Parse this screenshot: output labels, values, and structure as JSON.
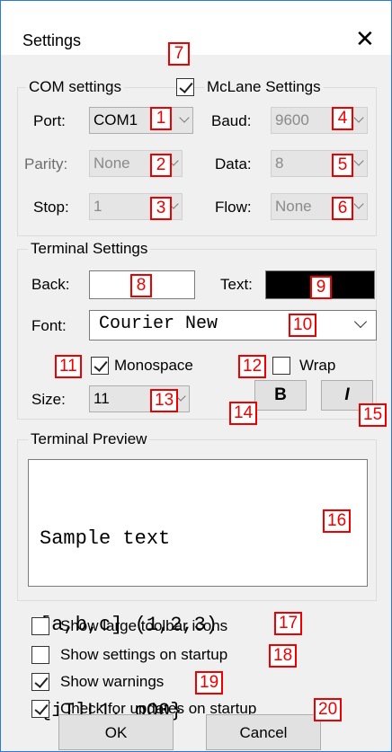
{
  "window": {
    "title": "Settings"
  },
  "com": {
    "legend": "COM settings",
    "port_label": "Port:",
    "port_value": "COM1",
    "parity_label": "Parity:",
    "parity_value": "None",
    "stop_label": "Stop:",
    "stop_value": "1",
    "baud_label": "Baud:",
    "baud_value": "9600",
    "data_label": "Data:",
    "data_value": "8",
    "flow_label": "Flow:",
    "flow_value": "None",
    "mclane_label": "McLane Settings",
    "mclane_checked": true
  },
  "terminal": {
    "legend": "Terminal Settings",
    "back_label": "Back:",
    "back_color": "#ffffff",
    "text_label": "Text:",
    "text_color": "#000000",
    "font_label": "Font:",
    "font_value": "Courier New",
    "monospace_label": "Monospace",
    "monospace_checked": true,
    "wrap_label": "Wrap",
    "wrap_checked": false,
    "size_label": "Size:",
    "size_value": "11",
    "bold_label": "B",
    "italic_label": "I"
  },
  "preview": {
    "legend": "Terminal Preview",
    "lines": [
      "Sample text",
      "[a,b,c] (1,2,3)",
      "{iIlL1, oO0}"
    ]
  },
  "options": [
    {
      "label": "Show large toolbar icons",
      "checked": false
    },
    {
      "label": "Show settings on startup",
      "checked": false
    },
    {
      "label": "Show warnings",
      "checked": true
    },
    {
      "label": "Check for updates on startup",
      "checked": true
    }
  ],
  "buttons": {
    "ok": "OK",
    "cancel": "Cancel"
  },
  "annotations": [
    "1",
    "2",
    "3",
    "4",
    "5",
    "6",
    "7",
    "8",
    "9",
    "10",
    "11",
    "12",
    "13",
    "14",
    "15",
    "16",
    "17",
    "18",
    "19",
    "20"
  ],
  "colors": {
    "annotation": "#ee0000",
    "window_border": "#2b79d8"
  }
}
